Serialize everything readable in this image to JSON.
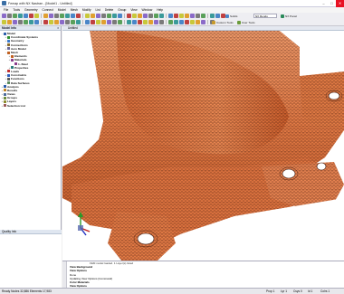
{
  "window": {
    "title": "Femap with NX Nastran - [Model1 - Untitled]",
    "controls": [
      "–",
      "□",
      "✕"
    ]
  },
  "menu": [
    "File",
    "Tools",
    "Geometry",
    "Connect",
    "Model",
    "Mesh",
    "Modify",
    "List",
    "Delete",
    "Group",
    "View",
    "Window",
    "Help"
  ],
  "toolbar": {
    "solid_btn": "Solids",
    "custom_tools": "Custom Tools",
    "user_tools": "User Tools",
    "view_select": "NX Rendu",
    "pan_btn": "NX Panel"
  },
  "model_info": {
    "header": "Model Info",
    "close": "x",
    "items": [
      {
        "label": "Model",
        "expander": "–",
        "level": 0,
        "color": "#2a5caa"
      },
      {
        "label": "Coordinate Systems",
        "expander": "+",
        "level": 1,
        "color": "#2f8f2f"
      },
      {
        "label": "Geometry",
        "expander": "+",
        "level": 1,
        "color": "#3a78c8"
      },
      {
        "label": "Connections",
        "expander": "+",
        "level": 1,
        "color": "#8a6a2a"
      },
      {
        "label": "Aero Model",
        "expander": "+",
        "level": 1,
        "color": "#6a6a9a"
      },
      {
        "label": "Mesh",
        "expander": "–",
        "level": 1,
        "color": "#c06020"
      },
      {
        "label": "Elements",
        "expander": "+",
        "level": 2,
        "color": "#c06020"
      },
      {
        "label": "Materials",
        "expander": "+",
        "level": 2,
        "color": "#8a3a8a"
      },
      {
        "label": "1..Steel",
        "expander": "",
        "level": 3,
        "color": "#8a3a8a"
      },
      {
        "label": "Properties",
        "expander": "+",
        "level": 2,
        "color": "#2a7a7a"
      },
      {
        "label": "Loads",
        "expander": "+",
        "level": 1,
        "color": "#c03030"
      },
      {
        "label": "Constraints",
        "expander": "+",
        "level": 1,
        "color": "#3060c0"
      },
      {
        "label": "Functions",
        "expander": "+",
        "level": 1,
        "color": "#5a5a5a"
      },
      {
        "label": "Data Surfaces",
        "expander": "+",
        "level": 1,
        "color": "#5a8a5a"
      },
      {
        "label": "Analysis",
        "expander": "+",
        "level": 0,
        "color": "#2a5caa"
      },
      {
        "label": "Results",
        "expander": "+",
        "level": 0,
        "color": "#c08020"
      },
      {
        "label": "Views",
        "expander": "+",
        "level": 0,
        "color": "#4a6a9a"
      },
      {
        "label": "Groups",
        "expander": "+",
        "level": 0,
        "color": "#6a8a3a"
      },
      {
        "label": "Layers",
        "expander": "+",
        "level": 0,
        "color": "#8a8a2a"
      },
      {
        "label": "Selection List",
        "expander": "+",
        "level": 0,
        "color": "#9a5a5a"
      }
    ]
  },
  "left_tabs": [
    "Model Info",
    "PostProcessing",
    "Meshing"
  ],
  "quality": {
    "header": "Quality Info"
  },
  "viewport": {
    "tab": "Untitled"
  },
  "messages": {
    "first": "FEM model loaded.   1 Layer(s) listed",
    "lines": [
      {
        "text": "View Background",
        "bold": true
      },
      {
        "text": "View Options",
        "bold": true
      },
      {
        "text": "Done",
        "bold": false
      },
      {
        "text": "Updating View Options (Command)",
        "bold": false
      },
      {
        "text": "Color Materials",
        "bold": true
      },
      {
        "text": "View Options",
        "bold": true
      }
    ]
  },
  "status": {
    "left": "Ready  Nodes 32,886  Elements 17,983",
    "prop": "Prop 1",
    "lyr": "Lyr 1",
    "csys": "Csys 0",
    "id": "Id 1",
    "cols": "Colrs 1"
  },
  "colors": {
    "mesh_fill": "#e27a45",
    "mesh_line": "#3a1408",
    "accent": "#3a6ea5"
  }
}
